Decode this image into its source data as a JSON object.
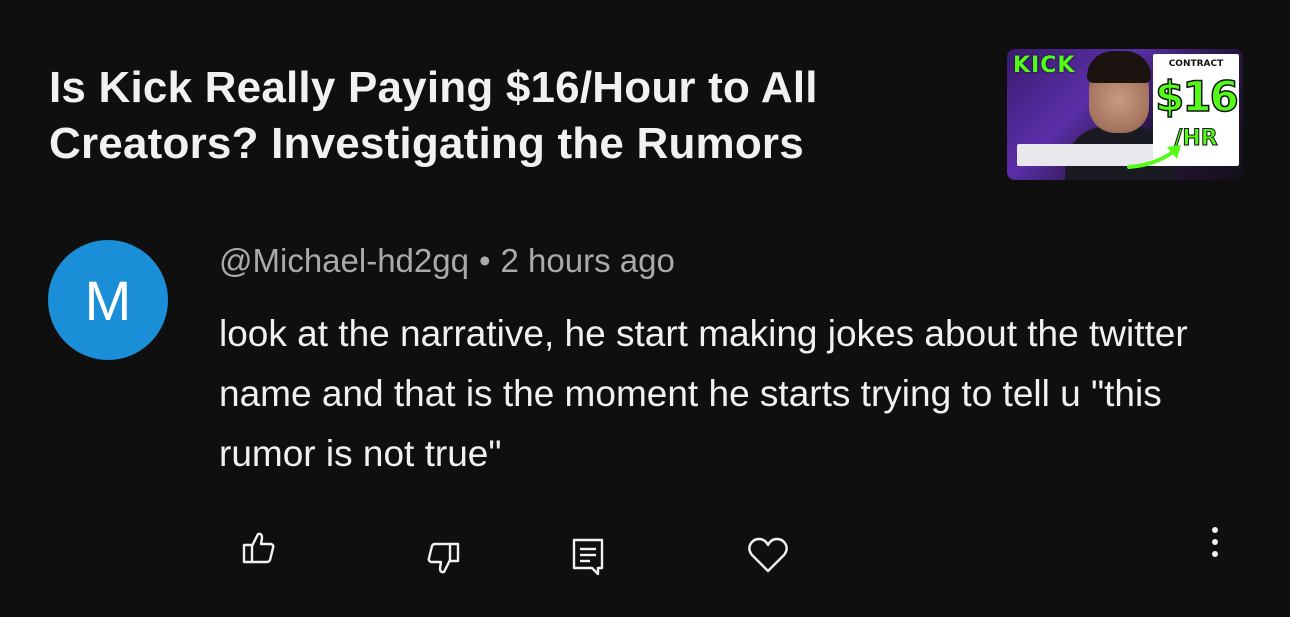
{
  "video": {
    "title": "Is Kick Really Paying $16/Hour to All Creators? Investigating the Rumors",
    "thumbnail": {
      "logo_text": "KICK",
      "contract_label": "CONTRACT",
      "price": "$16",
      "unit": "/HR",
      "accent_color": "#53fc18"
    }
  },
  "comment": {
    "avatar_letter": "M",
    "avatar_color": "#1a8fd8",
    "author": "@Michael-hd2gq",
    "separator": "•",
    "time": "2 hours ago",
    "text": "look at the narrative, he start making jokes about the twitter name and that is the moment he starts trying to tell u \"this rumor is not true\""
  },
  "actions": [
    {
      "icon": "thumbs-up-icon"
    },
    {
      "icon": "thumbs-down-icon"
    },
    {
      "icon": "reply-icon"
    },
    {
      "icon": "heart-icon"
    },
    {
      "icon": "more-vertical-icon"
    }
  ]
}
